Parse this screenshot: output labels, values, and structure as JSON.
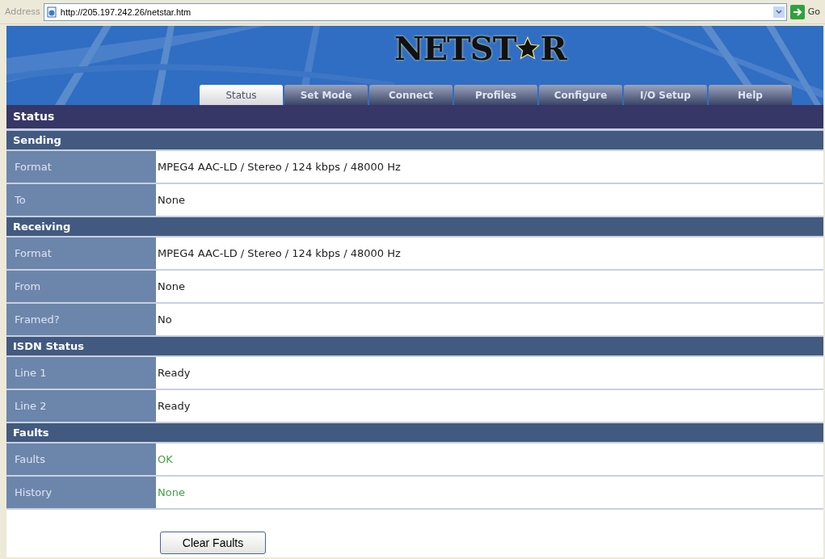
{
  "address_bar": {
    "label": "Address",
    "url": "http://205.197.242.26/netstar.htm",
    "go": "Go"
  },
  "logo": {
    "text_1": "NETST",
    "text_2": "R"
  },
  "tabs": [
    {
      "label": "Status",
      "selected": true
    },
    {
      "label": "Set Mode",
      "selected": false
    },
    {
      "label": "Connect",
      "selected": false
    },
    {
      "label": "Profiles",
      "selected": false
    },
    {
      "label": "Configure",
      "selected": false
    },
    {
      "label": "I/O Setup",
      "selected": false
    },
    {
      "label": "Help",
      "selected": false
    }
  ],
  "page_title": "Status",
  "sections": [
    {
      "title": "Sending",
      "rows": [
        {
          "label": "Format",
          "value": "MPEG4 AAC-LD / Stereo / 124 kbps / 48000 Hz",
          "kind": "plain"
        },
        {
          "label": "To",
          "value": "None",
          "kind": "plain"
        }
      ]
    },
    {
      "title": "Receiving",
      "rows": [
        {
          "label": "Format",
          "value": "MPEG4 AAC-LD / Stereo / 124 kbps / 48000 Hz",
          "kind": "plain"
        },
        {
          "label": "From",
          "value": "None",
          "kind": "plain"
        },
        {
          "label": "Framed?",
          "value": "No",
          "kind": "plain"
        }
      ]
    },
    {
      "title": "ISDN Status",
      "rows": [
        {
          "label": "Line 1",
          "value": "Ready",
          "kind": "plain"
        },
        {
          "label": "Line 2",
          "value": "Ready",
          "kind": "plain"
        }
      ]
    },
    {
      "title": "Faults",
      "rows": [
        {
          "label": "Faults",
          "value": "OK",
          "kind": "ok"
        },
        {
          "label": "History",
          "value": "None",
          "kind": "ok"
        }
      ]
    }
  ],
  "button": "Clear Faults"
}
